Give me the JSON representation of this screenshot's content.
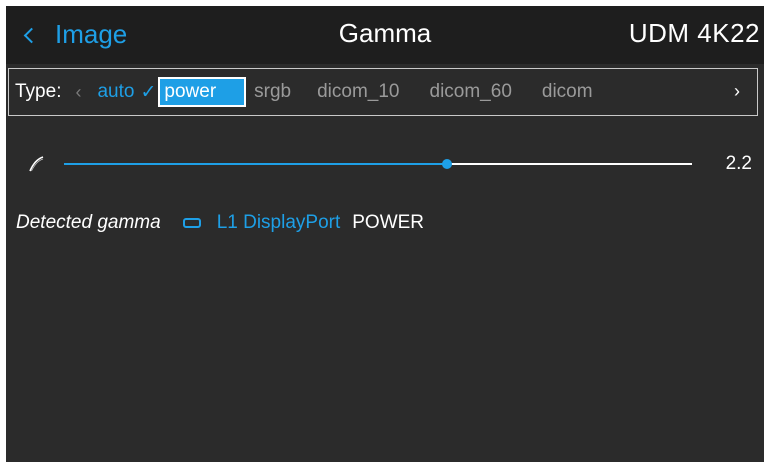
{
  "header": {
    "back_label": "Image",
    "title": "Gamma",
    "device": "UDM 4K22"
  },
  "type_selector": {
    "label": "Type:",
    "options": [
      "auto",
      "power",
      "srgb",
      "dicom_10",
      "dicom_60",
      "dicom"
    ],
    "checked": "auto",
    "focused": "power"
  },
  "gamma_slider": {
    "value": "2.2",
    "fill_fraction": 0.61
  },
  "detected": {
    "label": "Detected gamma",
    "source": "L1 DisplayPort",
    "value": "POWER"
  },
  "icons": {
    "back": "chevron-left-icon",
    "checked": "checkmark-icon",
    "scroll_left": "chevron-left-icon",
    "scroll_right": "chevron-right-icon",
    "gamma": "gamma-curve-icon",
    "source": "displayport-icon"
  },
  "colors": {
    "accent": "#1e9fe6",
    "background": "#2b2b2b",
    "header": "#1e1e1e",
    "text": "#ffffff",
    "muted": "#9a9a9a"
  }
}
